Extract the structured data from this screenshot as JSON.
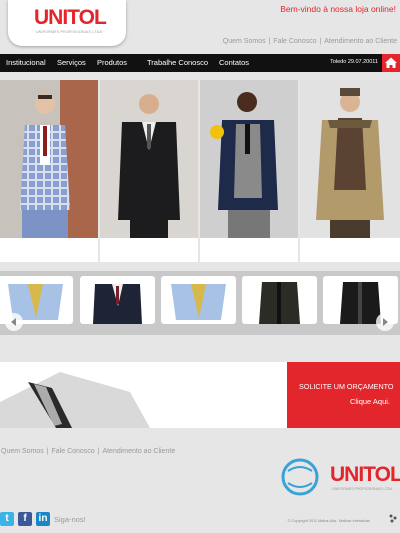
{
  "brand": {
    "name": "UNITOL",
    "tagline": "UNIFORMES PROFISSIONAIS LTDA"
  },
  "header": {
    "welcome": "Bem-vindo à nossa loja online!",
    "links": [
      "Quem Somos",
      "Fale Conosco",
      "Atendimento ao Cliente"
    ]
  },
  "nav": {
    "items": [
      "Institucional",
      "Serviços",
      "Produtos",
      "Trabalhe Conosco",
      "Contatos"
    ],
    "date": "Toledo 29.07.20011"
  },
  "banner": {
    "line1": "SOLICITE UM ORÇAMENTO",
    "line2": "Clique Aqui."
  },
  "footer": {
    "links": [
      "Quem Somos",
      "Fale Conosco",
      "Atendimento ao Cliente"
    ],
    "follow": "Siga-nos!",
    "copyright": "© Copyright 2011 Malha Alta - Malhas Interativas"
  },
  "colors": {
    "accent": "#e3262c",
    "nav": "#111111",
    "bg": "#e6e6e6"
  },
  "icons": [
    "home-icon",
    "twitter-icon",
    "facebook-icon",
    "linkedin-icon",
    "arrow-left-icon",
    "arrow-right-icon",
    "globe-icon"
  ]
}
